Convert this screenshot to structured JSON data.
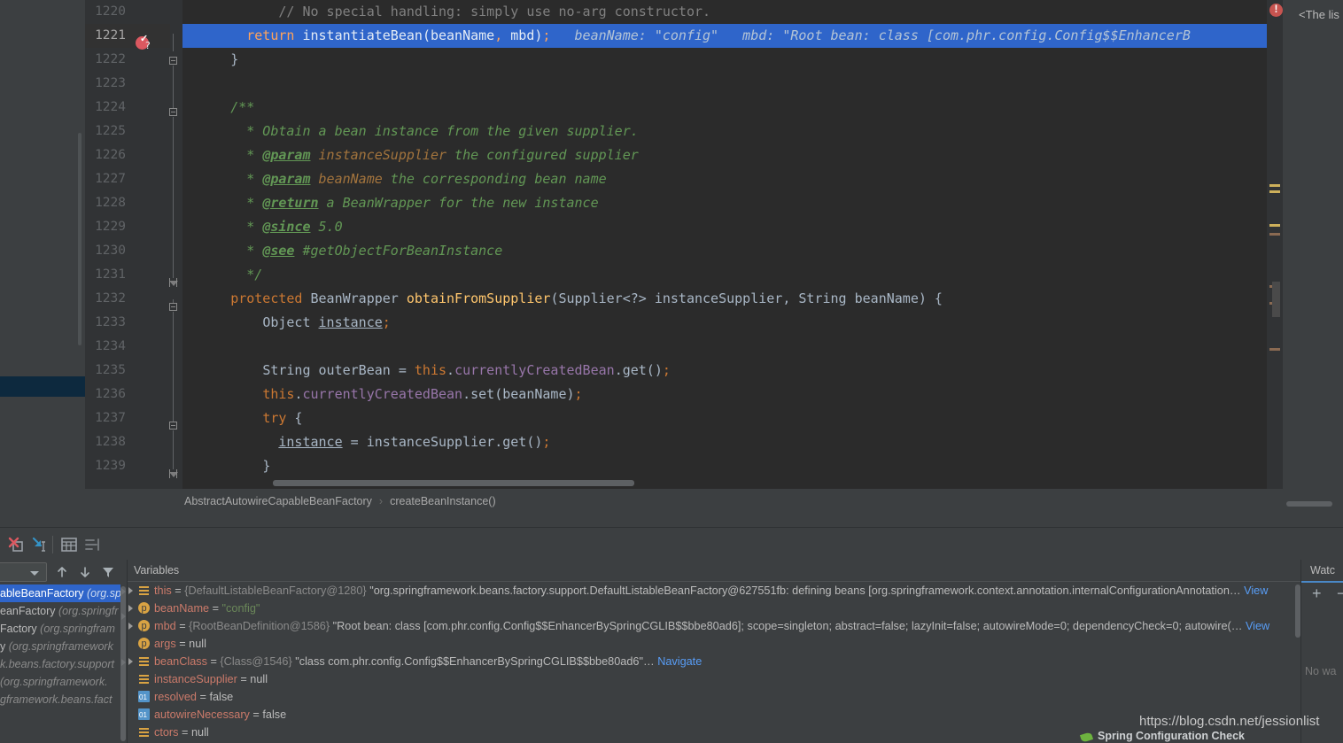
{
  "editor": {
    "lines": [
      {
        "num": "1220",
        "indent": 6,
        "segments": [
          {
            "cls": "cmt",
            "t": "// No special handling: simply use no-arg constructor."
          }
        ]
      },
      {
        "num": "1221",
        "highlight": true,
        "indent": 4,
        "segments": [
          {
            "cls": "hl-kw",
            "t": "return "
          },
          {
            "cls": "hl-txt",
            "t": "instantiateBean"
          },
          {
            "cls": "hl-txt",
            "t": "(beanName"
          },
          {
            "cls": "hl-kw",
            "t": ","
          },
          {
            "cls": "hl-txt",
            "t": " mbd)"
          },
          {
            "cls": "hl-kw",
            "t": ";"
          },
          {
            "cls": "hl-hint",
            "t": "   beanName: \"config\"   mbd: \"Root bean: class [com.phr.config.Config$$EnhancerB"
          }
        ]
      },
      {
        "num": "1222",
        "indent": 3,
        "segments": [
          {
            "cls": "punct",
            "t": "}"
          }
        ]
      },
      {
        "num": "1223",
        "indent": 0,
        "segments": []
      },
      {
        "num": "1224",
        "indent": 3,
        "segments": [
          {
            "cls": "doc",
            "t": "/**"
          }
        ]
      },
      {
        "num": "1225",
        "indent": 4,
        "segments": [
          {
            "cls": "doc",
            "t": "* Obtain a bean instance from the given supplier."
          }
        ]
      },
      {
        "num": "1226",
        "indent": 4,
        "segments": [
          {
            "cls": "doc",
            "t": "* "
          },
          {
            "cls": "doctag",
            "t": "@param"
          },
          {
            "cls": "docparam",
            "t": " instanceSupplier"
          },
          {
            "cls": "doc",
            "t": " the configured supplier"
          }
        ]
      },
      {
        "num": "1227",
        "indent": 4,
        "segments": [
          {
            "cls": "doc",
            "t": "* "
          },
          {
            "cls": "doctag",
            "t": "@param"
          },
          {
            "cls": "docparam",
            "t": " beanName"
          },
          {
            "cls": "doc",
            "t": " the corresponding bean name"
          }
        ]
      },
      {
        "num": "1228",
        "indent": 4,
        "segments": [
          {
            "cls": "doc",
            "t": "* "
          },
          {
            "cls": "doctag",
            "t": "@return"
          },
          {
            "cls": "doc",
            "t": " a BeanWrapper for the new instance"
          }
        ]
      },
      {
        "num": "1229",
        "indent": 4,
        "segments": [
          {
            "cls": "doc",
            "t": "* "
          },
          {
            "cls": "doctag",
            "t": "@since"
          },
          {
            "cls": "doc",
            "t": " 5.0"
          }
        ]
      },
      {
        "num": "1230",
        "indent": 4,
        "segments": [
          {
            "cls": "doc",
            "t": "* "
          },
          {
            "cls": "doctag",
            "t": "@see"
          },
          {
            "cls": "doc",
            "t": " #getObjectForBeanInstance"
          }
        ]
      },
      {
        "num": "1231",
        "indent": 4,
        "segments": [
          {
            "cls": "doc",
            "t": "*/"
          }
        ]
      },
      {
        "num": "1232",
        "indent": 3,
        "segments": [
          {
            "cls": "kw",
            "t": "protected "
          },
          {
            "cls": "typ",
            "t": "BeanWrapper "
          },
          {
            "cls": "mth",
            "t": "obtainFromSupplier"
          },
          {
            "cls": "punct",
            "t": "(Supplier<?> instanceSupplier, String beanName) {"
          }
        ]
      },
      {
        "num": "1233",
        "indent": 5,
        "segments": [
          {
            "cls": "typ",
            "t": "Object "
          },
          {
            "cls": "und",
            "t": "instance"
          },
          {
            "cls": "kw",
            "t": ";"
          }
        ]
      },
      {
        "num": "1234",
        "indent": 0,
        "segments": []
      },
      {
        "num": "1235",
        "indent": 5,
        "segments": [
          {
            "cls": "typ",
            "t": "String outerBean = "
          },
          {
            "cls": "kw",
            "t": "this"
          },
          {
            "cls": "punct",
            "t": "."
          },
          {
            "cls": "fld",
            "t": "currentlyCreatedBean"
          },
          {
            "cls": "punct",
            "t": ".get()"
          },
          {
            "cls": "kw",
            "t": ";"
          }
        ]
      },
      {
        "num": "1236",
        "indent": 5,
        "segments": [
          {
            "cls": "kw",
            "t": "this"
          },
          {
            "cls": "punct",
            "t": "."
          },
          {
            "cls": "fld",
            "t": "currentlyCreatedBean"
          },
          {
            "cls": "punct",
            "t": ".set(beanName)"
          },
          {
            "cls": "kw",
            "t": ";"
          }
        ]
      },
      {
        "num": "1237",
        "indent": 5,
        "segments": [
          {
            "cls": "kw",
            "t": "try"
          },
          {
            "cls": "punct",
            "t": " {"
          }
        ]
      },
      {
        "num": "1238",
        "indent": 6,
        "segments": [
          {
            "cls": "und",
            "t": "instance"
          },
          {
            "cls": "punct",
            "t": " = instanceSupplier.get()"
          },
          {
            "cls": "kw",
            "t": ";"
          }
        ]
      },
      {
        "num": "1239",
        "indent": 5,
        "segments": [
          {
            "cls": "punct",
            "t": "}"
          }
        ]
      }
    ],
    "tooltip_text": "<The lis",
    "breadcrumb": {
      "class_name": "AbstractAutowireCapableBeanFactory",
      "separator": "›",
      "method_name": "createBeanInstance()"
    }
  },
  "debug_toolbar": {
    "buttons": [
      {
        "name": "mute-breakpoints-button",
        "label": "Mute Breakpoints"
      },
      {
        "name": "step-into-button",
        "label": "Step Into"
      },
      {
        "name": "settings-button",
        "label": "Settings"
      },
      {
        "name": "layout-button",
        "label": "Layout"
      }
    ]
  },
  "frames": {
    "thread_combo_value": "",
    "toolbar": [
      {
        "name": "frames-up-button",
        "label": "↑"
      },
      {
        "name": "frames-down-button",
        "label": "↓"
      },
      {
        "name": "frames-filter-button",
        "label": "▼"
      }
    ],
    "rows": [
      {
        "method": "ableBeanFactory",
        "pkg": "(org.sp",
        "selected": true
      },
      {
        "method": "eanFactory",
        "pkg": "(org.springfr",
        "selected": false
      },
      {
        "method": "Factory",
        "pkg": "(org.springfram",
        "selected": false
      },
      {
        "method": "y",
        "pkg": "(org.springframework",
        "selected": false
      },
      {
        "method": "",
        "pkg": "k.beans.factory.support",
        "selected": false
      },
      {
        "method": "",
        "pkg": "(org.springframework.",
        "selected": false
      },
      {
        "method": "",
        "pkg": "gframework.beans.fact",
        "selected": false
      }
    ]
  },
  "variables": {
    "header": "Variables",
    "rows": [
      {
        "expandable": true,
        "icon": "obj",
        "name": "this",
        "eq": " = ",
        "ref": "{DefaultListableBeanFactory@1280} ",
        "value": "\"org.springframework.beans.factory.support.DefaultListableBeanFactory@627551fb: defining beans [org.springframework.context.annotation.internalConfigurationAnnotation…",
        "link": "View"
      },
      {
        "expandable": true,
        "icon": "param",
        "name": "beanName",
        "eq": " = ",
        "ref": "",
        "value_literal": "\"config\"",
        "link": ""
      },
      {
        "expandable": true,
        "icon": "param",
        "name": "mbd",
        "eq": " = ",
        "ref": "{RootBeanDefinition@1586} ",
        "value": "\"Root bean: class [com.phr.config.Config$$EnhancerBySpringCGLIB$$bbe80ad6]; scope=singleton; abstract=false; lazyInit=false; autowireMode=0; dependencyCheck=0; autowire(…",
        "link": "View"
      },
      {
        "expandable": false,
        "icon": "param",
        "name": "args",
        "eq": " = ",
        "ref": "",
        "value_null": "null",
        "link": ""
      },
      {
        "expandable": true,
        "icon": "obj",
        "name": "beanClass",
        "eq": " = ",
        "ref": "{Class@1546} ",
        "value": "\"class com.phr.config.Config$$EnhancerBySpringCGLIB$$bbe80ad6\"…",
        "link": "Navigate"
      },
      {
        "expandable": false,
        "icon": "obj",
        "name": "instanceSupplier",
        "eq": " = ",
        "ref": "",
        "value_null": "null",
        "link": ""
      },
      {
        "expandable": false,
        "icon": "prim",
        "name": "resolved",
        "eq": " = ",
        "ref": "",
        "value_null": "false",
        "link": ""
      },
      {
        "expandable": false,
        "icon": "prim",
        "name": "autowireNecessary",
        "eq": " = ",
        "ref": "",
        "value_null": "false",
        "link": ""
      },
      {
        "expandable": false,
        "icon": "obj",
        "name": "ctors",
        "eq": " = ",
        "ref": "",
        "value_null": "null",
        "link": ""
      }
    ]
  },
  "watches": {
    "title": "Watc",
    "add_label": "+",
    "remove_label": "−",
    "empty_text": "No wa"
  },
  "watermark": "https://blog.csdn.net/jessionlist",
  "notification": {
    "text": "Spring Configuration Check"
  },
  "colors": {
    "accent_blue": "#2f65ca",
    "panel_bg": "#3c3f41",
    "editor_bg": "#2b2b2b",
    "error_red": "#c75450",
    "spring_green": "#6db33f"
  }
}
